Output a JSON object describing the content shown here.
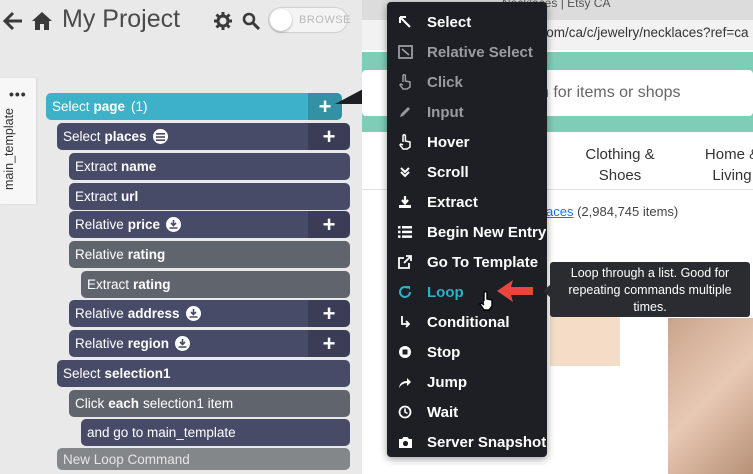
{
  "app": {
    "title": "My Project",
    "browse_label": "BROWSE",
    "template_tab": "main_template"
  },
  "commands": [
    {
      "prefix": "Select",
      "bold": "page",
      "suffix": "(1)"
    },
    {
      "prefix": "Select",
      "bold": "places"
    },
    {
      "prefix": "Extract",
      "bold": "name"
    },
    {
      "prefix": "Extract",
      "bold": "url"
    },
    {
      "prefix": "Relative",
      "bold": "price"
    },
    {
      "prefix": "Relative",
      "bold": "rating"
    },
    {
      "prefix": "Extract",
      "bold": "rating"
    },
    {
      "prefix": "Relative",
      "bold": "address"
    },
    {
      "prefix": "Relative",
      "bold": "region"
    },
    {
      "prefix": "Select",
      "bold": "selection1"
    },
    {
      "prefix": "Click",
      "bold": "each",
      "suffix": "selection1 item"
    },
    {
      "prefix": "and go to main_template"
    },
    {
      "prefix": "New Loop Command"
    }
  ],
  "menu": [
    {
      "label": "Select",
      "icon": "cursor-icon",
      "state": "normal"
    },
    {
      "label": "Relative Select",
      "icon": "relative-select-icon",
      "state": "dim"
    },
    {
      "label": "Click",
      "icon": "click-hand-icon",
      "state": "dim"
    },
    {
      "label": "Input",
      "icon": "pencil-icon",
      "state": "dim"
    },
    {
      "label": "Hover",
      "icon": "hover-hand-icon",
      "state": "normal"
    },
    {
      "label": "Scroll",
      "icon": "scroll-icon",
      "state": "normal"
    },
    {
      "label": "Extract",
      "icon": "download-icon",
      "state": "normal"
    },
    {
      "label": "Begin New Entry",
      "icon": "list-icon",
      "state": "normal"
    },
    {
      "label": "Go To Template",
      "icon": "external-link-icon",
      "state": "normal"
    },
    {
      "label": "Loop",
      "icon": "loop-icon",
      "state": "selected"
    },
    {
      "label": "Conditional",
      "icon": "conditional-icon",
      "state": "normal"
    },
    {
      "label": "Stop",
      "icon": "stop-icon",
      "state": "normal"
    },
    {
      "label": "Jump",
      "icon": "jump-icon",
      "state": "normal"
    },
    {
      "label": "Wait",
      "icon": "clock-icon",
      "state": "normal"
    },
    {
      "label": "Server Snapshot",
      "icon": "camera-icon",
      "state": "normal"
    }
  ],
  "tooltip": "Loop through a list. Good for repeating commands multiple times.",
  "browser": {
    "tab_title": "Necklaces | Etsy CA",
    "url_visible": "y.com/ca/c/jewelry/necklaces?ref=ca",
    "search_placeholder": "h for items or shops",
    "nav_clothing": "Clothing & Shoes",
    "nav_home": "Home & Living",
    "crumb_link": "aces",
    "crumb_count": "(2,984,745 items)"
  },
  "colors": {
    "accent": "#3db1c7",
    "menu_bg": "#1d1f24",
    "arrow": "#e8453c"
  }
}
